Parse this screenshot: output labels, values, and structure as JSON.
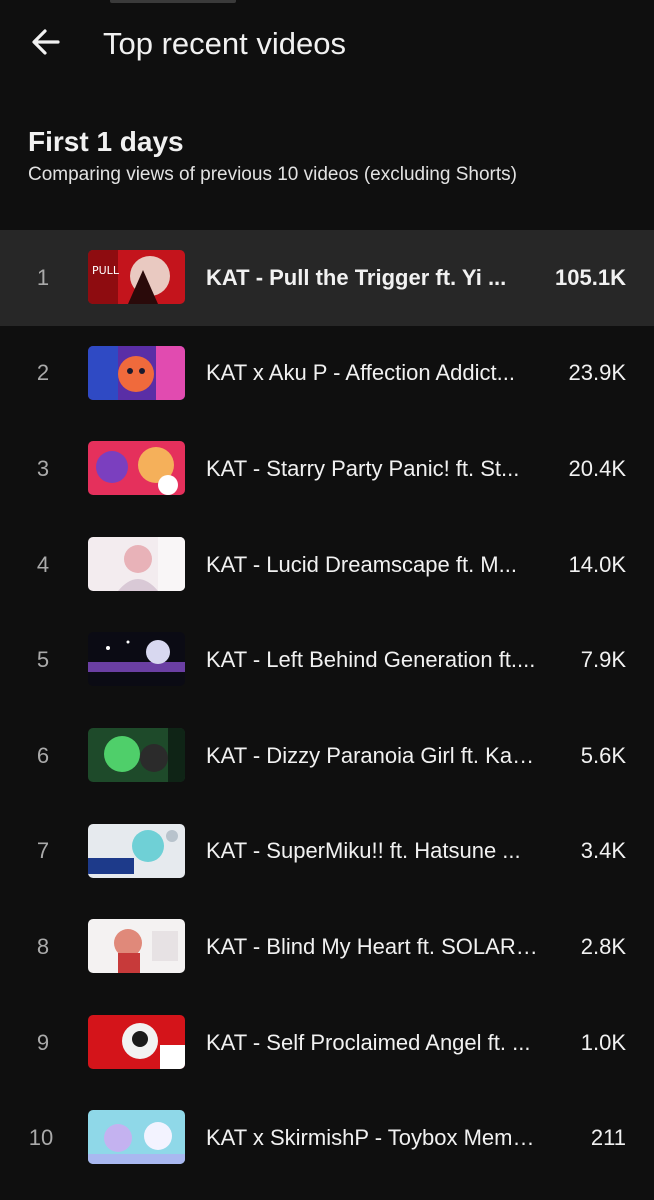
{
  "app_bar": {
    "title": "Top recent videos",
    "back_icon": "arrow-left-icon"
  },
  "section": {
    "title": "First 1 days",
    "subtitle": "Comparing views of previous 10 videos (excluding Shorts)"
  },
  "videos": [
    {
      "rank": "1",
      "title": "KAT - Pull the Trigger ft. Yi ...",
      "views": "105.1K",
      "highlighted": true
    },
    {
      "rank": "2",
      "title": "KAT x Aku P - Affection Addict...",
      "views": "23.9K"
    },
    {
      "rank": "3",
      "title": "KAT - Starry Party Panic! ft. St...",
      "views": "20.4K"
    },
    {
      "rank": "4",
      "title": "KAT - Lucid Dreamscape ft. M...",
      "views": "14.0K"
    },
    {
      "rank": "5",
      "title": "KAT - Left Behind Generation ft....",
      "views": "7.9K"
    },
    {
      "rank": "6",
      "title": "KAT - Dizzy Paranoia Girl ft. Kas...",
      "views": "5.6K"
    },
    {
      "rank": "7",
      "title": "KAT - SuperMiku!! ft. Hatsune ...",
      "views": "3.4K"
    },
    {
      "rank": "8",
      "title": "KAT - Blind My Heart ft. SOLARI...",
      "views": "2.8K"
    },
    {
      "rank": "9",
      "title": "KAT - Self Proclaimed Angel ft. ...",
      "views": "1.0K"
    },
    {
      "rank": "10",
      "title": "KAT x SkirmishP - Toybox Memo...",
      "views": "211"
    }
  ]
}
